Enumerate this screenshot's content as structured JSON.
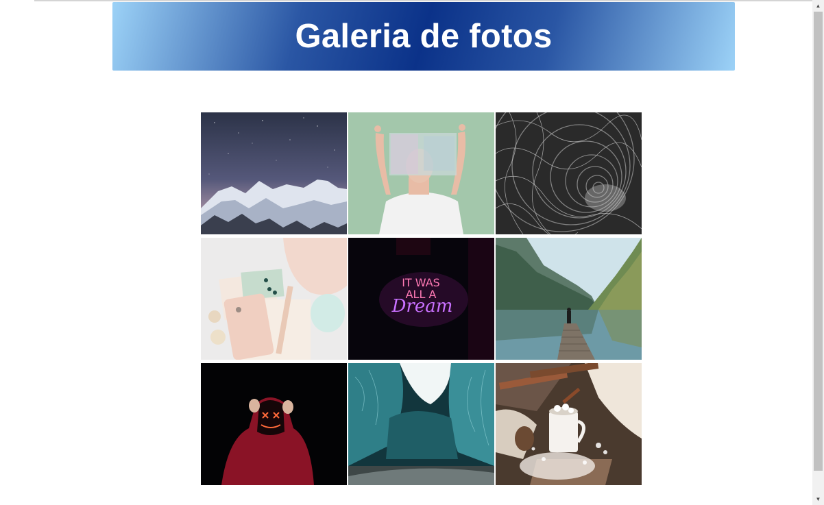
{
  "header": {
    "title": "Galeria de fotos"
  },
  "gallery": {
    "photos": [
      {
        "subject": "starry-night-mountains"
      },
      {
        "subject": "person-holding-glass-sheet"
      },
      {
        "subject": "abstract-spiral"
      },
      {
        "subject": "phone-and-accessories-flatlay"
      },
      {
        "subject": "neon-sign"
      },
      {
        "subject": "lake-dock-mountains"
      },
      {
        "subject": "neon-mask-hoodie"
      },
      {
        "subject": "ice-cave"
      },
      {
        "subject": "cocoa-mug-winter"
      }
    ]
  },
  "scrollbar": {
    "up_icon": "▲",
    "down_icon": "▼"
  }
}
